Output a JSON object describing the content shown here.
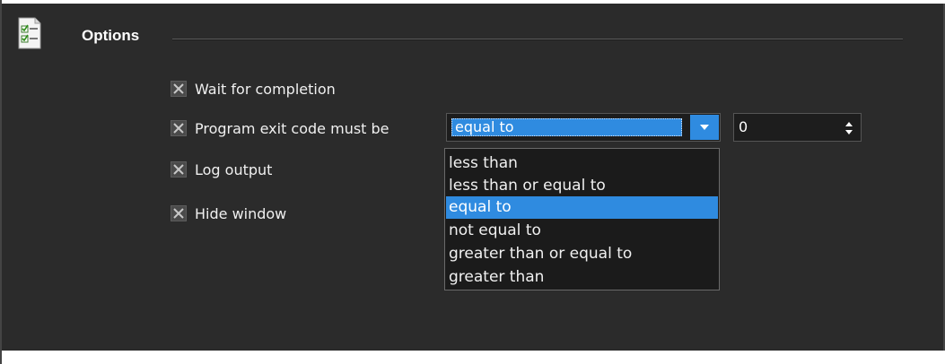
{
  "section": {
    "title": "Options",
    "icon": "checklist-icon"
  },
  "options": [
    {
      "label": "Wait for completion",
      "checked": true
    },
    {
      "label": "Program exit code must be",
      "checked": true
    },
    {
      "label": "Log output",
      "checked": true
    },
    {
      "label": "Hide window",
      "checked": true
    }
  ],
  "exit_code_condition": {
    "selected": "equal to",
    "items": [
      "less than",
      "less than or equal to",
      "equal to",
      "not equal to",
      "greater than or equal to",
      "greater than"
    ]
  },
  "exit_code_value": "0",
  "colors": {
    "background": "#2b2b2b",
    "accent": "#2f8be0"
  }
}
